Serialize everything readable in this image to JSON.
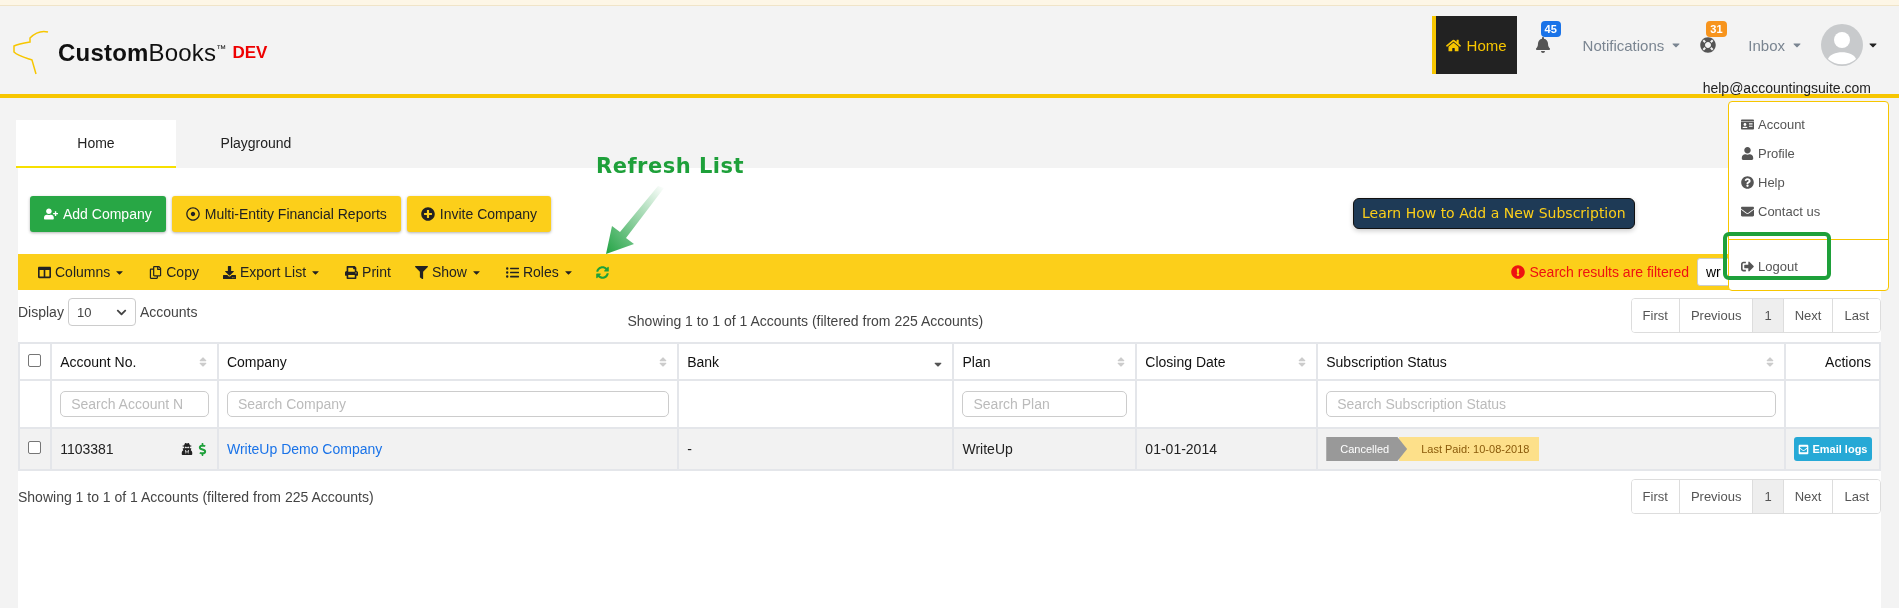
{
  "header": {
    "logo": {
      "brand": "**Custom**Books$^{™}$",
      "tag": "DEV"
    },
    "nav": [
      {
        "kind": "home",
        "label": "Home",
        "selected": true
      },
      {
        "kind": "notifications",
        "label": "Notifications",
        "badge": "45",
        "color": "#1a73e8"
      },
      {
        "kind": "inbox",
        "label": "Inbox",
        "badge": "31",
        "color": "#f7941d"
      }
    ],
    "user_email": "help@accountingsuite.com"
  },
  "user_menu": {
    "items": [
      {
        "kind": "item",
        "label": "Account"
      },
      {
        "kind": "item",
        "label": "Profile"
      },
      {
        "kind": "item",
        "label": "Help"
      },
      {
        "kind": "item",
        "label": "Contact us"
      },
      {
        "kind": "separated",
        "label": "Logout"
      }
    ]
  },
  "tabs": [
    {
      "label": "Home",
      "selected": true
    },
    {
      "label": "Playground",
      "selected": false
    }
  ],
  "actions": [
    {
      "kind": "primary",
      "label": "Add Company"
    },
    {
      "kind": "secondary",
      "label": "Multi-Entity Financial Reports"
    },
    {
      "kind": "secondary",
      "label": "Invite Company"
    }
  ],
  "learn_button": "Learn How to Add a New Subscription",
  "toolbar": {
    "items": [
      {
        "label": "Columns",
        "dropdown": true
      },
      {
        "label": "Copy",
        "dropdown": false
      },
      {
        "label": "Export List",
        "dropdown": true
      },
      {
        "label": "Print",
        "dropdown": false
      },
      {
        "label": "Show",
        "dropdown": true
      },
      {
        "label": "Roles",
        "dropdown": true
      }
    ],
    "filter_notice": "Search results are filtered",
    "search_value": "wr"
  },
  "annotations": {
    "refresh_label": "Refresh List",
    "highlight_logout": true
  },
  "display": {
    "before": "Display",
    "value": "10",
    "after": "Accounts"
  },
  "info_top": "Showing 1 to 1 of 1 Accounts (filtered from 225 Accounts)",
  "pagination_top": [
    {
      "label": "First",
      "selected": false
    },
    {
      "label": "Previous",
      "selected": false
    },
    {
      "label": "1",
      "selected": true
    },
    {
      "label": "Next",
      "selected": false
    },
    {
      "label": "Last",
      "selected": false
    }
  ],
  "table": {
    "select_all_checked": false,
    "columns": [
      {
        "label": "Account No.",
        "sortable": true,
        "sorted": false,
        "placeholder": "Search Account N"
      },
      {
        "label": "Company",
        "sortable": true,
        "sorted": false,
        "placeholder": "Search Company"
      },
      {
        "label": "Bank",
        "sortable": true,
        "sorted": true
      },
      {
        "label": "Plan",
        "sortable": true,
        "sorted": false,
        "placeholder": "Search Plan"
      },
      {
        "label": "Closing Date",
        "sortable": true,
        "sorted": false
      },
      {
        "label": "Subscription Status",
        "sortable": true,
        "sorted": false,
        "placeholder": "Search Subscription Status"
      },
      {
        "label": "Actions",
        "sortable": false
      }
    ],
    "rows": [
      {
        "checked": false,
        "account": "1103381",
        "company": "WriteUp Demo Company",
        "bank": "-",
        "plan": "WriteUp",
        "closing_date": "01-01-2014",
        "status": "Cancelled",
        "last_paid": "Last Paid: 10-08-2018",
        "action": "Email logs"
      }
    ]
  },
  "info_bottom": "Showing 1 to 1 of 1 Accounts (filtered from 225 Accounts)",
  "pagination_bottom": [
    {
      "label": "First",
      "selected": false
    },
    {
      "label": "Previous",
      "selected": false
    },
    {
      "label": "1",
      "selected": true
    },
    {
      "label": "Next",
      "selected": false
    },
    {
      "label": "Last",
      "selected": false
    }
  ]
}
